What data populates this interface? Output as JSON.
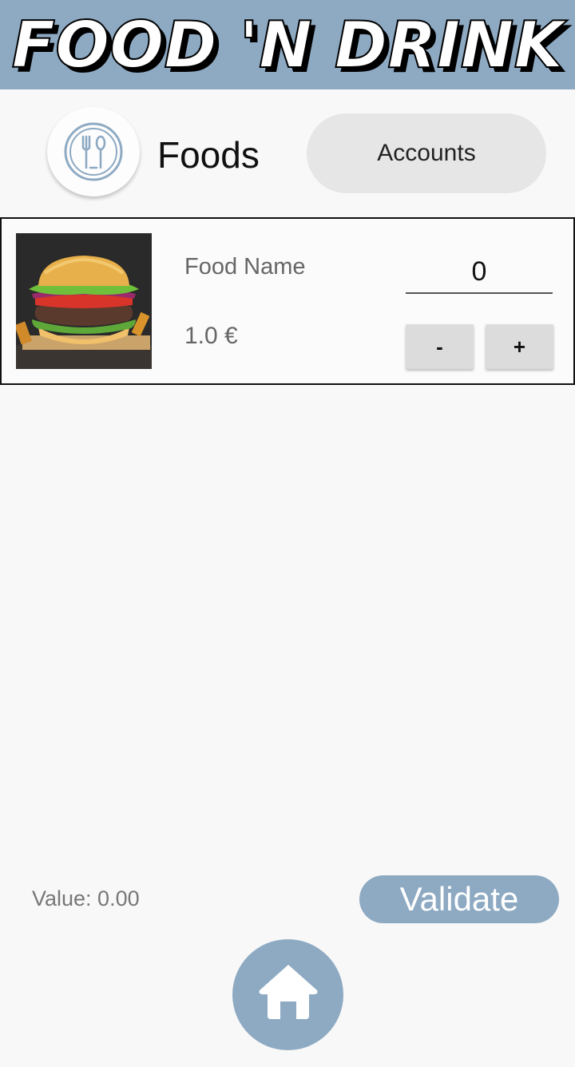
{
  "app": {
    "logo_text": "FOOD 'N DRINK",
    "brand_color": "#8eaac3"
  },
  "category": {
    "icon": "utensils-icon",
    "title": "Foods"
  },
  "nav": {
    "accounts_label": "Accounts"
  },
  "items": [
    {
      "image": "burger-image",
      "name": "Food Name",
      "price": "1.0 €",
      "quantity": "0",
      "decrement_label": "-",
      "increment_label": "+"
    }
  ],
  "footer": {
    "value_text": "Value: 0.00",
    "validate_label": "Validate",
    "home_icon": "home-icon"
  }
}
